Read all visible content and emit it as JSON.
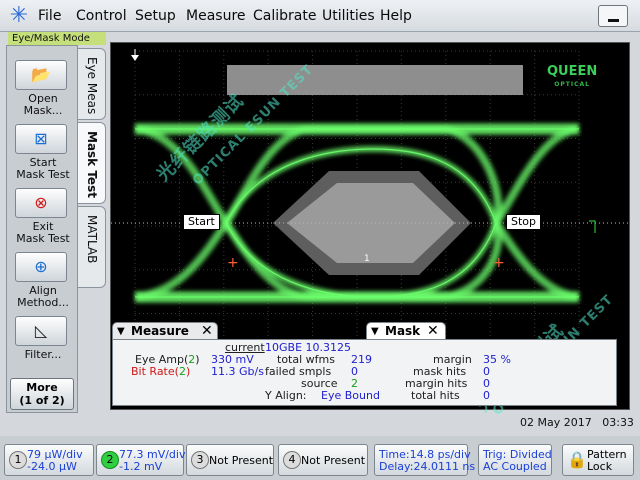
{
  "menu": {
    "file": "File",
    "control": "Control",
    "setup": "Setup",
    "measure": "Measure",
    "calibrate": "Calibrate",
    "utilities": "Utilities",
    "help": "Help"
  },
  "mode_tab": "Eye/Mask Mode",
  "left_buttons": [
    {
      "label1": "Open",
      "label2": "Mask..."
    },
    {
      "label1": "Start",
      "label2": "Mask Test"
    },
    {
      "label1": "Exit",
      "label2": "Mask Test"
    },
    {
      "label1": "Align",
      "label2": "Method..."
    },
    {
      "label1": "Filter...",
      "label2": ""
    }
  ],
  "more": {
    "line1": "More",
    "line2": "(1 of 2)"
  },
  "side_tabs": [
    "Eye Meas",
    "Mask Test",
    "MATLAB"
  ],
  "logo_text": "QUEEN",
  "logo_sub": "OPTICAL",
  "markers": {
    "start": "Start",
    "stop": "Stop"
  },
  "mask_label": "1",
  "watermarks": [
    "光纤链路测试",
    "OPTICAL ESUN TEST",
    "光纤链路测试",
    "OPTICAL ESUN TEST"
  ],
  "measure_panel": {
    "tab_measure": "Measure",
    "tab_mask": "Mask",
    "col_current": "current",
    "rows": [
      {
        "name": "Eye Amp(",
        "ch": "2",
        "close": ")",
        "value": "330 mV"
      },
      {
        "name": "Bit Rate(",
        "ch": "2",
        "close": ")",
        "value": "11.3 Gb/s"
      }
    ],
    "standard": "10GBE 10.3125",
    "total_wfms_label": "total wfms",
    "total_wfms": "219",
    "failed_smpls_label": "failed smpls",
    "failed_smpls": "0",
    "source_label": "source",
    "source": "2",
    "y_align_label": "Y Align:",
    "y_align": "Eye Bound",
    "margin_label": "margin",
    "margin": "35 %",
    "mask_hits_label": "mask hits",
    "mask_hits": "0",
    "margin_hits_label": "margin hits",
    "margin_hits": "0",
    "total_hits_label": "total hits",
    "total_hits": "0"
  },
  "date": "02 May 2017",
  "time": "03:33",
  "bottom": {
    "ch1": {
      "num": "1",
      "scale": "79 µW/div",
      "offset": "-24.0 µW"
    },
    "ch2": {
      "num": "2",
      "scale": "77.3 mV/div",
      "offset": "-1.2 mV"
    },
    "ch3": {
      "num": "3",
      "label": "Not Present"
    },
    "ch4": {
      "num": "4",
      "label": "Not Present"
    },
    "timebase": {
      "time": "Time:14.8 ps/div",
      "delay": "Delay:24.0111 ns"
    },
    "trigger": {
      "trig": "Trig: Divided",
      "coupling": "AC Coupled"
    },
    "lock": {
      "line1": "Pattern",
      "line2": "Lock"
    }
  },
  "colors": {
    "trace": "#6cff6c",
    "mask": "#9a9a9a",
    "margin": "#6a6a6a",
    "accent": "#c5e07a"
  }
}
